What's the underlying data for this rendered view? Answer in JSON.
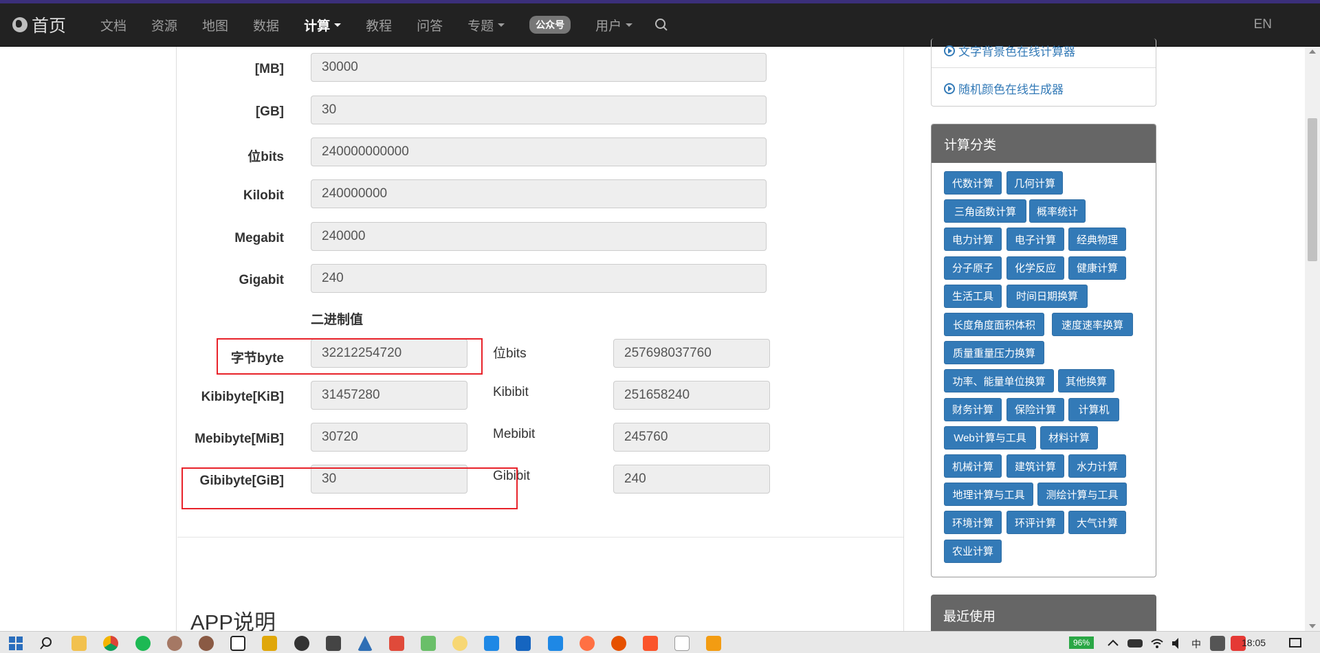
{
  "nav": {
    "brand": "首页",
    "items": [
      {
        "label": "文档",
        "active": false,
        "dropdown": false
      },
      {
        "label": "资源",
        "active": false,
        "dropdown": false
      },
      {
        "label": "地图",
        "active": false,
        "dropdown": false
      },
      {
        "label": "数据",
        "active": false,
        "dropdown": false
      },
      {
        "label": "计算",
        "active": true,
        "dropdown": true
      },
      {
        "label": "教程",
        "active": false,
        "dropdown": false
      },
      {
        "label": "问答",
        "active": false,
        "dropdown": false
      },
      {
        "label": "专题",
        "active": false,
        "dropdown": true
      }
    ],
    "badge": "公众号",
    "user": "用户",
    "lang": "EN"
  },
  "decimal": {
    "mb_label": "[MB]",
    "mb_value": "30000",
    "gb_label": "[GB]",
    "gb_value": "30",
    "bits_label": "位bits",
    "bits_value": "240000000000",
    "kilobit_label": "Kilobit",
    "kilobit_value": "240000000",
    "megabit_label": "Megabit",
    "megabit_value": "240000",
    "gigabit_label": "Gigabit",
    "gigabit_value": "240"
  },
  "binary": {
    "title": "二进制值",
    "byte_label": "字节byte",
    "byte_value": "32212254720",
    "bits_label": "位bits",
    "bits_value": "257698037760",
    "kib_label": "Kibibyte[KiB]",
    "kib_value": "31457280",
    "kibibit_label": "Kibibit",
    "kibibit_value": "251658240",
    "mib_label": "Mebibyte[MiB]",
    "mib_value": "30720",
    "mebibit_label": "Mebibit",
    "mebibit_value": "245760",
    "gib_label": "Gibibyte[GiB]",
    "gib_value": "30",
    "gibibit_label": "Gibibit",
    "gibibit_value": "240"
  },
  "app_title": "APP说明",
  "sidebar": {
    "link1": "文字背景色在线计算器",
    "link2": "随机颜色在线生成器",
    "categories_title": "计算分类",
    "categories": [
      "代数计算",
      "几何计算",
      "三角函数计算",
      "概率统计",
      "电力计算",
      "电子计算",
      "经典物理",
      "分子原子",
      "化学反应",
      "健康计算",
      "生活工具",
      "时间日期换算",
      "长度角度面积体积",
      "速度速率换算",
      "质量重量压力换算",
      "功率、能量单位换算",
      "其他换算",
      "财务计算",
      "保险计算",
      "计算机",
      "Web计算与工具",
      "材料计算",
      "机械计算",
      "建筑计算",
      "水力计算",
      "地理计算与工具",
      "测绘计算与工具",
      "环境计算",
      "环评计算",
      "大气计算",
      "农业计算"
    ],
    "recent_title": "最近使用"
  },
  "taskbar": {
    "battery": "96%",
    "ime": "中",
    "clock": "18:05"
  }
}
